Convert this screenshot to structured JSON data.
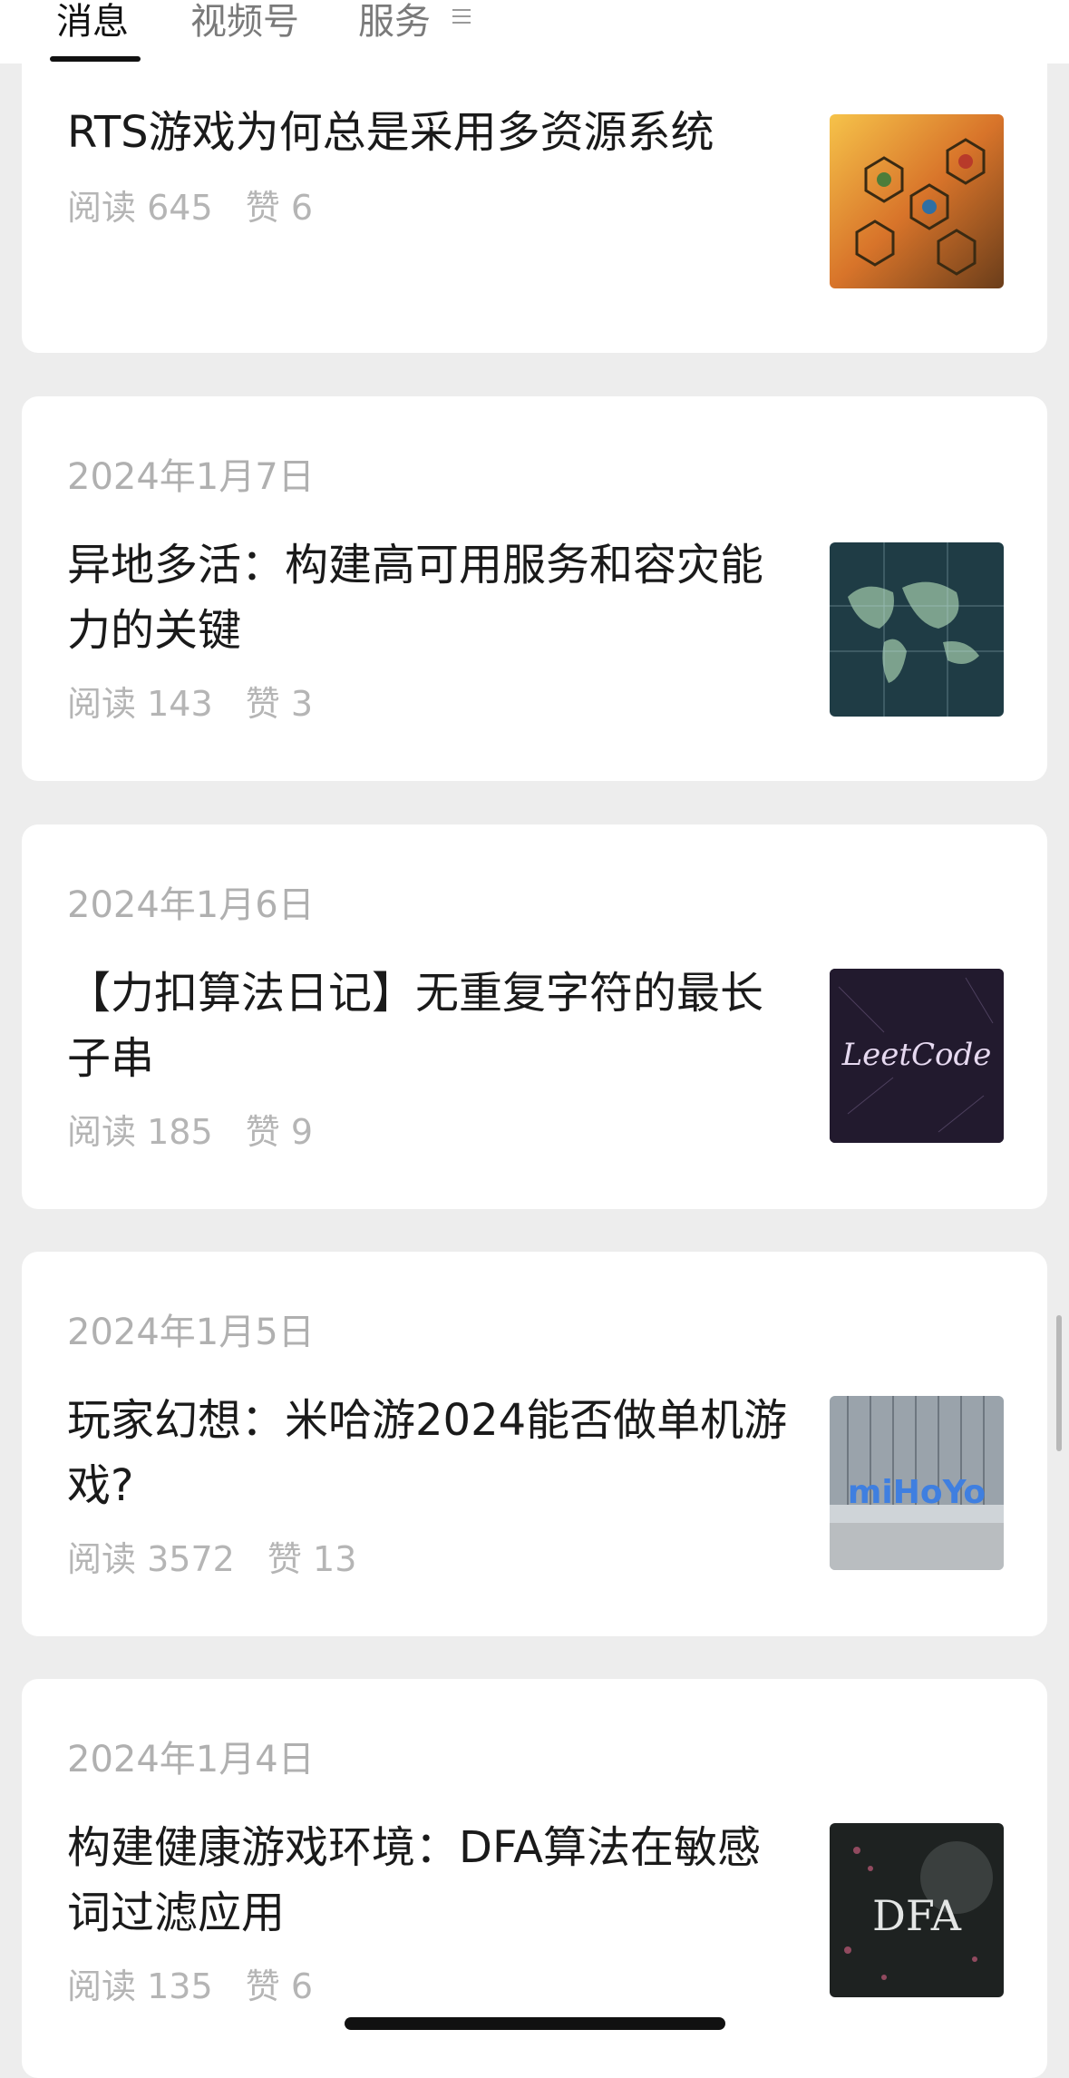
{
  "tabs": [
    {
      "label": "消息",
      "active": true
    },
    {
      "label": "视频号",
      "active": false
    },
    {
      "label": "服务",
      "active": false
    }
  ],
  "articles": [
    {
      "date": "",
      "title": "RTS游戏为何总是采用多资源系统",
      "reads_label": "阅读",
      "reads": "645",
      "likes_label": "赞",
      "likes": "6",
      "thumb_icon": "hex-resource-map-image"
    },
    {
      "date": "2024年1月7日",
      "title": "异地多活：构建高可用服务和容灾能力的关键",
      "reads_label": "阅读",
      "reads": "143",
      "likes_label": "赞",
      "likes": "3",
      "thumb_icon": "world-map-image"
    },
    {
      "date": "2024年1月6日",
      "title": "【力扣算法日记】无重复字符的最长子串",
      "reads_label": "阅读",
      "reads": "185",
      "likes_label": "赞",
      "likes": "9",
      "thumb_icon": "leetcode-image",
      "thumb_text": "LeetCode"
    },
    {
      "date": "2024年1月5日",
      "title": "玩家幻想：米哈游2024能否做单机游戏?",
      "reads_label": "阅读",
      "reads": "3572",
      "likes_label": "赞",
      "likes": "13",
      "thumb_icon": "mihoyo-building-image",
      "thumb_text": "miHoYo"
    },
    {
      "date": "2024年1月4日",
      "title": "构建健康游戏环境：DFA算法在敏感词过滤应用",
      "reads_label": "阅读",
      "reads": "135",
      "likes_label": "赞",
      "likes": "6",
      "thumb_icon": "dfa-image",
      "thumb_text": "DFA"
    }
  ],
  "colors": {
    "background": "#ededed",
    "card": "#ffffff",
    "active_tab": "#111111",
    "muted": "#b0b0b0"
  }
}
